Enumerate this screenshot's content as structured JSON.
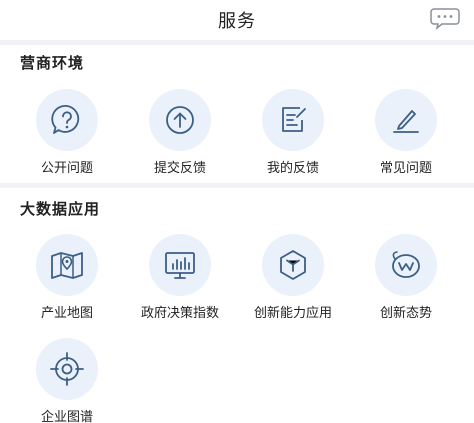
{
  "header": {
    "title": "服务",
    "chat_icon": "chat-bubble-icon"
  },
  "sections": [
    {
      "title": "营商环境",
      "items": [
        {
          "label": "公开问题",
          "icon": "question-icon"
        },
        {
          "label": "提交反馈",
          "icon": "upload-arrow-icon"
        },
        {
          "label": "我的反馈",
          "icon": "edit-note-icon"
        },
        {
          "label": "常见问题",
          "icon": "pen-icon"
        }
      ]
    },
    {
      "title": "大数据应用",
      "items": [
        {
          "label": "产业地图",
          "icon": "map-pin-icon"
        },
        {
          "label": "政府决策指数",
          "icon": "monitor-chart-icon"
        },
        {
          "label": "创新能力应用",
          "icon": "cube-icon"
        },
        {
          "label": "创新态势",
          "icon": "trend-icon"
        },
        {
          "label": "企业图谱",
          "icon": "target-icon"
        }
      ]
    }
  ],
  "colors": {
    "icon_stroke": "#3d5f86",
    "circle_bg": "#eaf1fa",
    "divider": "#f0f2f5"
  }
}
